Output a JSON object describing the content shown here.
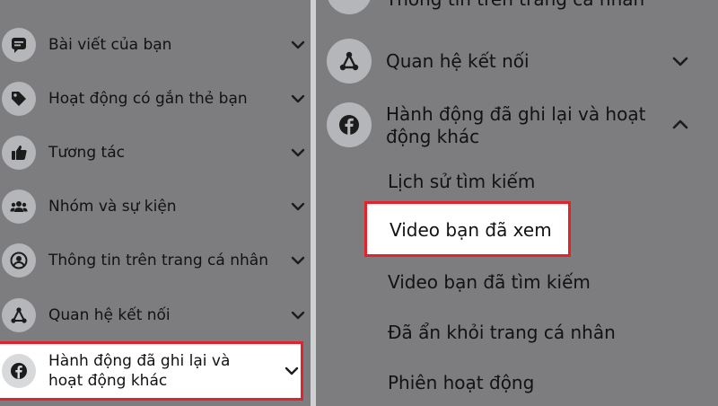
{
  "left_panel": {
    "items": [
      {
        "label": "Bài viết của bạn",
        "icon": "post-icon"
      },
      {
        "label": "Hoạt động có gắn thẻ bạn",
        "icon": "tag-icon"
      },
      {
        "label": "Tương tác",
        "icon": "thumbs-up-icon"
      },
      {
        "label": "Nhóm và sự kiện",
        "icon": "group-icon"
      },
      {
        "label": "Thông tin trên trang cá nhân",
        "icon": "profile-icon"
      },
      {
        "label": "Quan hệ kết nối",
        "icon": "connections-icon"
      },
      {
        "label": "Hành động đã ghi lại và hoạt động khác",
        "icon": "facebook-icon"
      }
    ]
  },
  "right_panel": {
    "top_partial_label": "Thông tin trên trang cá nhân",
    "connections": {
      "label": "Quan hệ kết nối",
      "icon": "connections-icon"
    },
    "logged_actions": {
      "label_line1": "Hành động đã ghi lại và hoạt",
      "label_line2": "động khác",
      "icon": "facebook-icon"
    },
    "sub_items": [
      {
        "label": "Lịch sử tìm kiếm"
      },
      {
        "label": "Video bạn đã xem"
      },
      {
        "label": "Video bạn đã tìm kiếm"
      },
      {
        "label": "Đã ẩn khỏi trang cá nhân"
      },
      {
        "label": "Phiên hoạt động"
      }
    ]
  },
  "colors": {
    "highlight_border": "#e4222c",
    "background": "#7d7d7f"
  }
}
